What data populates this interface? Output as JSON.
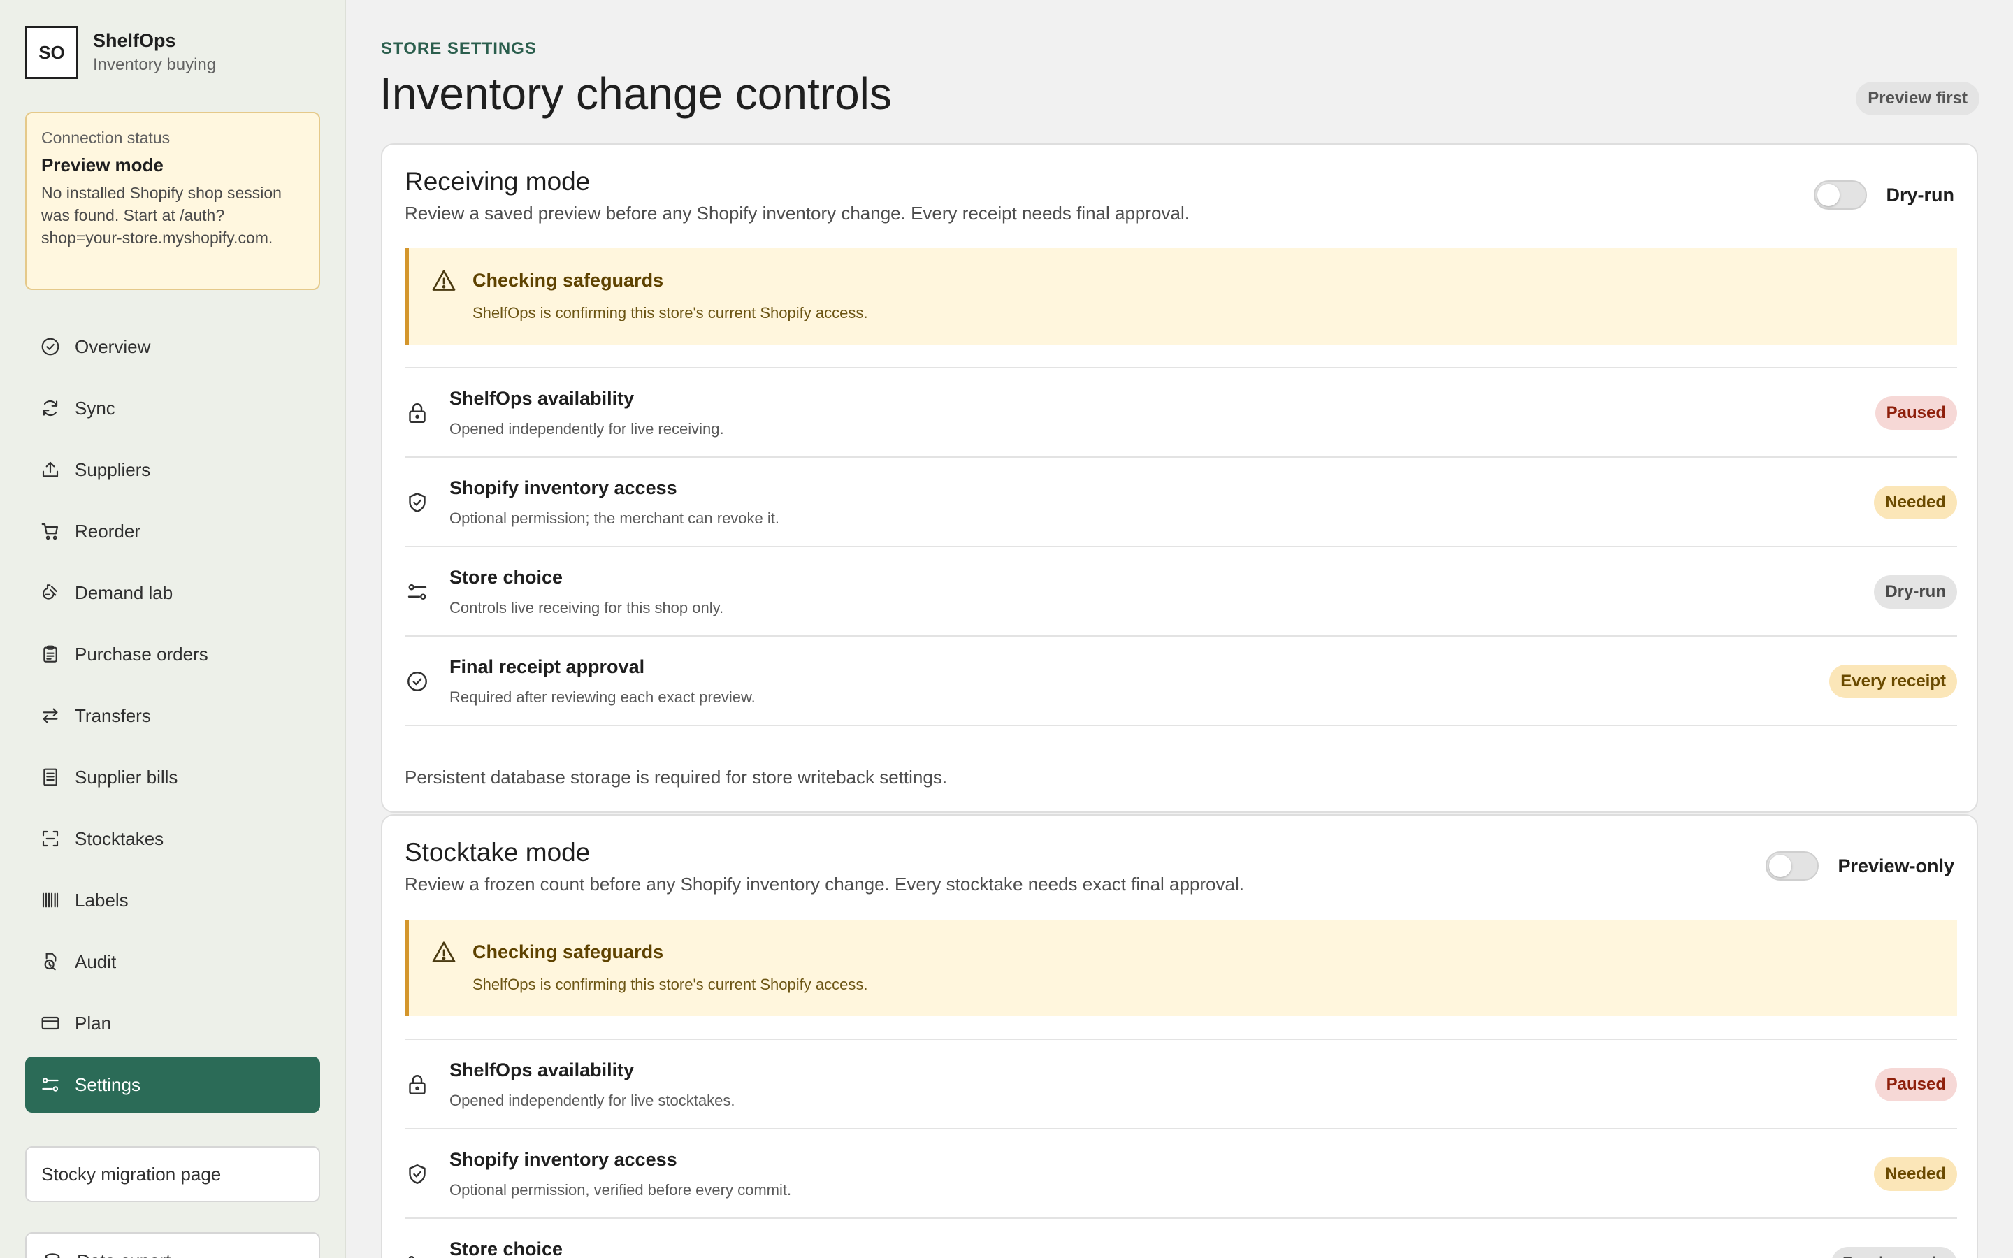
{
  "brand": {
    "logo": "SO",
    "name": "ShelfOps",
    "subtitle": "Inventory buying"
  },
  "connection": {
    "label": "Connection status",
    "mode": "Preview mode",
    "message": "No installed Shopify shop session was found. Start at /auth?shop=your-store.myshopify.com."
  },
  "nav": {
    "items": [
      {
        "label": "Overview",
        "icon": "check-circle-icon"
      },
      {
        "label": "Sync",
        "icon": "refresh-icon"
      },
      {
        "label": "Suppliers",
        "icon": "upload-icon"
      },
      {
        "label": "Reorder",
        "icon": "cart-icon"
      },
      {
        "label": "Demand lab",
        "icon": "lab-icon"
      },
      {
        "label": "Purchase orders",
        "icon": "clipboard-icon"
      },
      {
        "label": "Transfers",
        "icon": "arrows-icon"
      },
      {
        "label": "Supplier bills",
        "icon": "receipt-icon"
      },
      {
        "label": "Stocktakes",
        "icon": "scan-icon"
      },
      {
        "label": "Labels",
        "icon": "barcode-icon"
      },
      {
        "label": "Audit",
        "icon": "audit-icon"
      },
      {
        "label": "Plan",
        "icon": "card-icon"
      },
      {
        "label": "Settings",
        "icon": "sliders-icon",
        "active": true
      }
    ],
    "migration_link": "Stocky migration page",
    "next_item_label": "Data export"
  },
  "header": {
    "eyebrow": "STORE SETTINGS",
    "title": "Inventory change controls",
    "status_pill": "Preview first"
  },
  "receiving": {
    "title": "Receiving mode",
    "description": "Review a saved preview before any Shopify inventory change. Every receipt needs final approval.",
    "toggle_label": "Dry-run",
    "toggle_on": false,
    "alert": {
      "title": "Checking safeguards",
      "text": "ShelfOps is confirming this store's current Shopify access."
    },
    "rows": [
      {
        "title": "ShelfOps availability",
        "subtitle": "Opened independently for live receiving.",
        "badge": "Paused",
        "tone": "critical",
        "icon": "lock-icon"
      },
      {
        "title": "Shopify inventory access",
        "subtitle": "Optional permission; the merchant can revoke it.",
        "badge": "Needed",
        "tone": "warning",
        "icon": "shield-check-icon"
      },
      {
        "title": "Store choice",
        "subtitle": "Controls live receiving for this shop only.",
        "badge": "Dry-run",
        "tone": "neutral",
        "icon": "sliders-icon"
      },
      {
        "title": "Final receipt approval",
        "subtitle": "Required after reviewing each exact preview.",
        "badge": "Every receipt",
        "tone": "warning",
        "icon": "check-circle-icon"
      }
    ],
    "footnote": "Persistent database storage is required for store writeback settings."
  },
  "stocktake": {
    "title": "Stocktake mode",
    "description": "Review a frozen count before any Shopify inventory change. Every stocktake needs exact final approval.",
    "toggle_label": "Preview-only",
    "toggle_on": false,
    "alert": {
      "title": "Checking safeguards",
      "text": "ShelfOps is confirming this store's current Shopify access."
    },
    "rows": [
      {
        "title": "ShelfOps availability",
        "subtitle": "Opened independently for live stocktakes.",
        "badge": "Paused",
        "tone": "critical",
        "icon": "lock-icon"
      },
      {
        "title": "Shopify inventory access",
        "subtitle": "Optional permission, verified before every commit.",
        "badge": "Needed",
        "tone": "warning",
        "icon": "shield-check-icon"
      },
      {
        "title": "Store choice",
        "subtitle": "",
        "badge": "Preview-only",
        "tone": "neutral",
        "icon": "sliders-icon"
      }
    ]
  },
  "colors": {
    "accent": "#2b6b57",
    "sidebar_bg": "#edf0e9",
    "warning_bg": "#fff6dd",
    "warning_border": "#d4962c",
    "critical_badge": "#f6d8d6",
    "warning_badge": "#fbe6b8"
  }
}
